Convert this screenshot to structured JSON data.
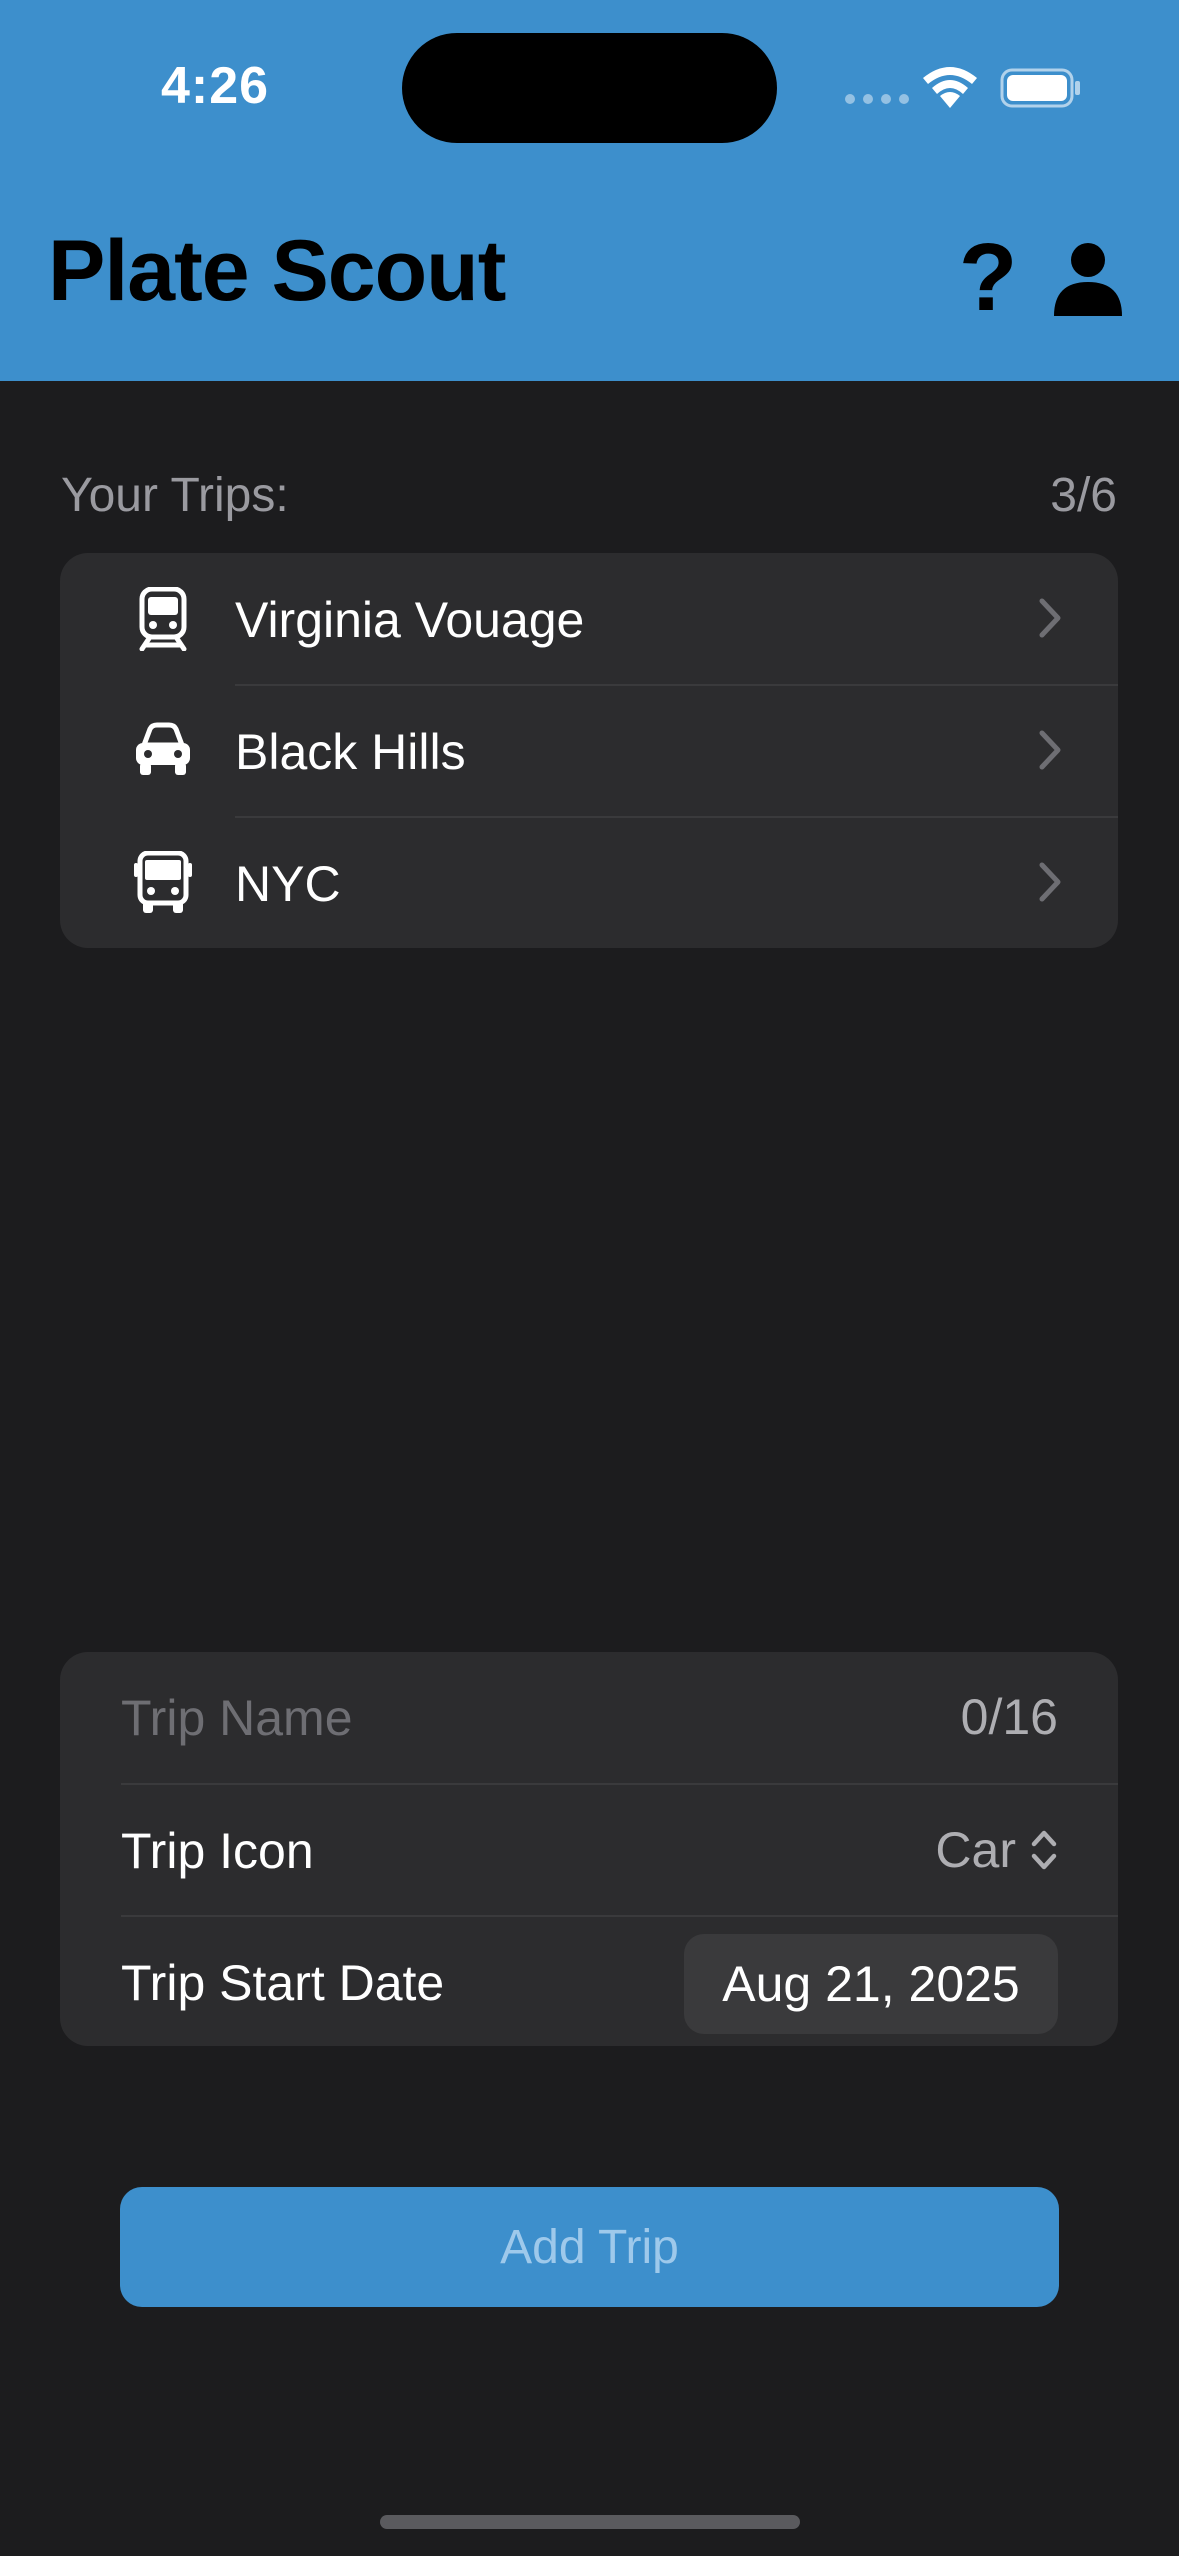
{
  "status_bar": {
    "time": "4:26",
    "wifi_icon": "wifi-icon",
    "battery_icon": "battery-icon",
    "signal_icon": "cellular-signal-icon"
  },
  "header": {
    "title": "Plate Scout",
    "help_icon": "question-mark-icon",
    "help_glyph": "?",
    "profile_icon": "person-icon"
  },
  "trips": {
    "label": "Your Trips:",
    "count": "3/6",
    "items": [
      {
        "name": "Virginia Vouage",
        "icon": "train-icon"
      },
      {
        "name": "Black Hills",
        "icon": "car-icon"
      },
      {
        "name": "NYC",
        "icon": "bus-icon"
      }
    ]
  },
  "form": {
    "name_placeholder": "Trip Name",
    "name_value": "",
    "name_count": "0/16",
    "icon_label": "Trip Icon",
    "icon_value": "Car",
    "start_date_label": "Trip Start Date",
    "start_date_value": "Aug 21, 2025"
  },
  "actions": {
    "add_trip_label": "Add Trip"
  },
  "colors": {
    "accent": "#3d8fcc",
    "background": "#1c1c1e",
    "card": "#2c2c2e",
    "secondary_text": "#9a9aa0"
  }
}
